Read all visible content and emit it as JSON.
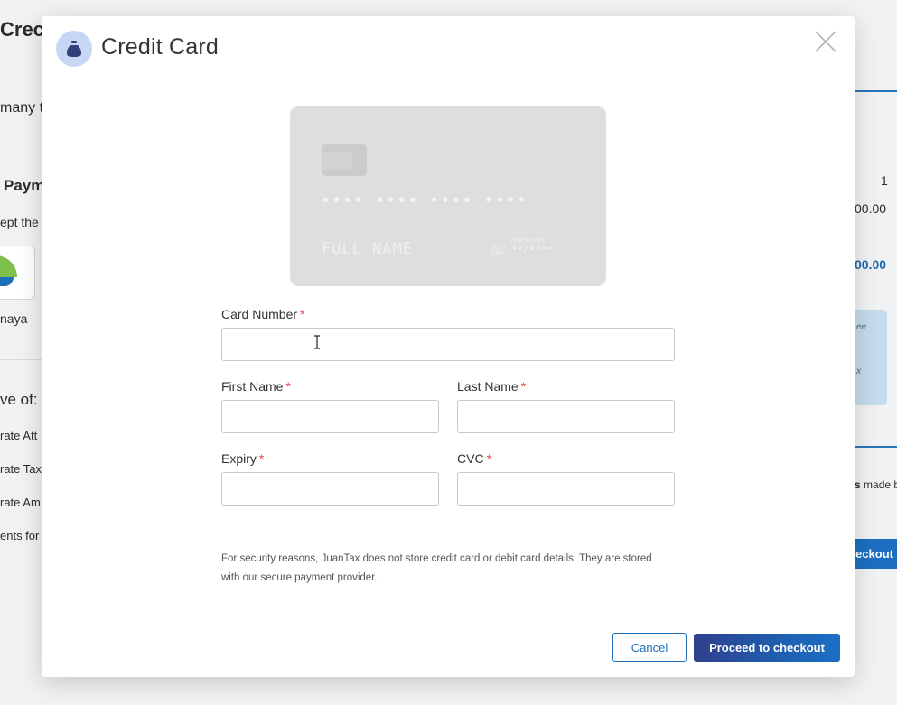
{
  "background": {
    "title_fragment": "Crec",
    "subtitle_fragment": "many t",
    "payment_heading_fragment": "Paym",
    "accept_fragment": "ept the",
    "maya_label_fragment": "naya",
    "save_of_fragment": "ve of:",
    "list_fragments": [
      "rate Att",
      "rate Tax",
      "rate Am",
      "ents for"
    ],
    "right_count": "1",
    "right_amount": "00.00",
    "right_total": "00.00",
    "promo_fragments": [
      "ee",
      "x"
    ],
    "made_by_fragment": "made b",
    "made_by_bold_fragment": "s",
    "checkout_fragment": "heckout"
  },
  "modal": {
    "title": "Credit Card",
    "icon": "money-bag-icon",
    "close_icon": "close-icon",
    "card_preview": {
      "number_mask": "•••• •••• •••• ••••",
      "name_placeholder": "FULL NAME",
      "valid_label_top": "MONTH/YEAR",
      "valid_label_side": "VALID THRU",
      "expiry_mask": "••/••••"
    },
    "fields": {
      "card_number": {
        "label": "Card Number",
        "value": "",
        "required": "*"
      },
      "first_name": {
        "label": "First Name",
        "value": "",
        "required": "*"
      },
      "last_name": {
        "label": "Last Name",
        "value": "",
        "required": "*"
      },
      "expiry": {
        "label": "Expiry",
        "value": "",
        "required": "*"
      },
      "cvc": {
        "label": "CVC",
        "value": "",
        "required": "*"
      }
    },
    "security_note": "For security reasons, JuanTax does not store credit card or debit card details. They are stored with our secure payment provider.",
    "buttons": {
      "cancel": "Cancel",
      "proceed": "Proceed to checkout"
    }
  },
  "colors": {
    "required": "#e04b4b",
    "primary": "#1c6fb8",
    "proceed_gradient_start": "#2f3f8c",
    "icon_circle": "#c6d6f3"
  }
}
